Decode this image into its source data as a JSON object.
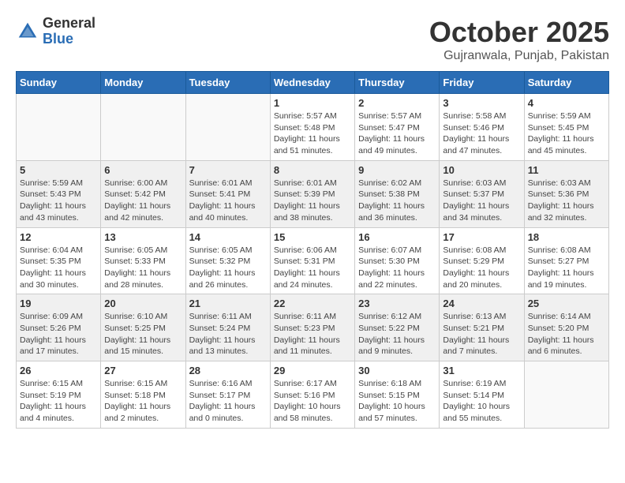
{
  "logo": {
    "general": "General",
    "blue": "Blue"
  },
  "title": "October 2025",
  "location": "Gujranwala, Punjab, Pakistan",
  "headers": [
    "Sunday",
    "Monday",
    "Tuesday",
    "Wednesday",
    "Thursday",
    "Friday",
    "Saturday"
  ],
  "weeks": [
    [
      {
        "day": "",
        "info": ""
      },
      {
        "day": "",
        "info": ""
      },
      {
        "day": "",
        "info": ""
      },
      {
        "day": "1",
        "info": "Sunrise: 5:57 AM\nSunset: 5:48 PM\nDaylight: 11 hours\nand 51 minutes."
      },
      {
        "day": "2",
        "info": "Sunrise: 5:57 AM\nSunset: 5:47 PM\nDaylight: 11 hours\nand 49 minutes."
      },
      {
        "day": "3",
        "info": "Sunrise: 5:58 AM\nSunset: 5:46 PM\nDaylight: 11 hours\nand 47 minutes."
      },
      {
        "day": "4",
        "info": "Sunrise: 5:59 AM\nSunset: 5:45 PM\nDaylight: 11 hours\nand 45 minutes."
      }
    ],
    [
      {
        "day": "5",
        "info": "Sunrise: 5:59 AM\nSunset: 5:43 PM\nDaylight: 11 hours\nand 43 minutes."
      },
      {
        "day": "6",
        "info": "Sunrise: 6:00 AM\nSunset: 5:42 PM\nDaylight: 11 hours\nand 42 minutes."
      },
      {
        "day": "7",
        "info": "Sunrise: 6:01 AM\nSunset: 5:41 PM\nDaylight: 11 hours\nand 40 minutes."
      },
      {
        "day": "8",
        "info": "Sunrise: 6:01 AM\nSunset: 5:39 PM\nDaylight: 11 hours\nand 38 minutes."
      },
      {
        "day": "9",
        "info": "Sunrise: 6:02 AM\nSunset: 5:38 PM\nDaylight: 11 hours\nand 36 minutes."
      },
      {
        "day": "10",
        "info": "Sunrise: 6:03 AM\nSunset: 5:37 PM\nDaylight: 11 hours\nand 34 minutes."
      },
      {
        "day": "11",
        "info": "Sunrise: 6:03 AM\nSunset: 5:36 PM\nDaylight: 11 hours\nand 32 minutes."
      }
    ],
    [
      {
        "day": "12",
        "info": "Sunrise: 6:04 AM\nSunset: 5:35 PM\nDaylight: 11 hours\nand 30 minutes."
      },
      {
        "day": "13",
        "info": "Sunrise: 6:05 AM\nSunset: 5:33 PM\nDaylight: 11 hours\nand 28 minutes."
      },
      {
        "day": "14",
        "info": "Sunrise: 6:05 AM\nSunset: 5:32 PM\nDaylight: 11 hours\nand 26 minutes."
      },
      {
        "day": "15",
        "info": "Sunrise: 6:06 AM\nSunset: 5:31 PM\nDaylight: 11 hours\nand 24 minutes."
      },
      {
        "day": "16",
        "info": "Sunrise: 6:07 AM\nSunset: 5:30 PM\nDaylight: 11 hours\nand 22 minutes."
      },
      {
        "day": "17",
        "info": "Sunrise: 6:08 AM\nSunset: 5:29 PM\nDaylight: 11 hours\nand 20 minutes."
      },
      {
        "day": "18",
        "info": "Sunrise: 6:08 AM\nSunset: 5:27 PM\nDaylight: 11 hours\nand 19 minutes."
      }
    ],
    [
      {
        "day": "19",
        "info": "Sunrise: 6:09 AM\nSunset: 5:26 PM\nDaylight: 11 hours\nand 17 minutes."
      },
      {
        "day": "20",
        "info": "Sunrise: 6:10 AM\nSunset: 5:25 PM\nDaylight: 11 hours\nand 15 minutes."
      },
      {
        "day": "21",
        "info": "Sunrise: 6:11 AM\nSunset: 5:24 PM\nDaylight: 11 hours\nand 13 minutes."
      },
      {
        "day": "22",
        "info": "Sunrise: 6:11 AM\nSunset: 5:23 PM\nDaylight: 11 hours\nand 11 minutes."
      },
      {
        "day": "23",
        "info": "Sunrise: 6:12 AM\nSunset: 5:22 PM\nDaylight: 11 hours\nand 9 minutes."
      },
      {
        "day": "24",
        "info": "Sunrise: 6:13 AM\nSunset: 5:21 PM\nDaylight: 11 hours\nand 7 minutes."
      },
      {
        "day": "25",
        "info": "Sunrise: 6:14 AM\nSunset: 5:20 PM\nDaylight: 11 hours\nand 6 minutes."
      }
    ],
    [
      {
        "day": "26",
        "info": "Sunrise: 6:15 AM\nSunset: 5:19 PM\nDaylight: 11 hours\nand 4 minutes."
      },
      {
        "day": "27",
        "info": "Sunrise: 6:15 AM\nSunset: 5:18 PM\nDaylight: 11 hours\nand 2 minutes."
      },
      {
        "day": "28",
        "info": "Sunrise: 6:16 AM\nSunset: 5:17 PM\nDaylight: 11 hours\nand 0 minutes."
      },
      {
        "day": "29",
        "info": "Sunrise: 6:17 AM\nSunset: 5:16 PM\nDaylight: 10 hours\nand 58 minutes."
      },
      {
        "day": "30",
        "info": "Sunrise: 6:18 AM\nSunset: 5:15 PM\nDaylight: 10 hours\nand 57 minutes."
      },
      {
        "day": "31",
        "info": "Sunrise: 6:19 AM\nSunset: 5:14 PM\nDaylight: 10 hours\nand 55 minutes."
      },
      {
        "day": "",
        "info": ""
      }
    ]
  ]
}
